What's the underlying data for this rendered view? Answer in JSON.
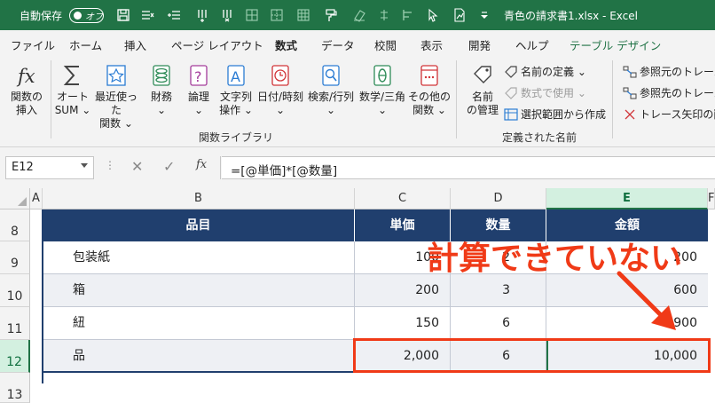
{
  "titlebar": {
    "autosave_label": "自動保存",
    "autosave_state": "オフ",
    "filename": "青色の請求書1.xlsx - Excel"
  },
  "tabs": [
    {
      "label": "ファイル"
    },
    {
      "label": "ホーム"
    },
    {
      "label": "挿入"
    },
    {
      "label": "ページ レイアウト"
    },
    {
      "label": "数式",
      "active": true
    },
    {
      "label": "データ"
    },
    {
      "label": "校閲"
    },
    {
      "label": "表示"
    },
    {
      "label": "開発"
    },
    {
      "label": "ヘルプ"
    },
    {
      "label": "テーブル デザイン",
      "contextual": true
    }
  ],
  "ribbon": {
    "function_library": {
      "insert_function": [
        "関数の",
        "挿入"
      ],
      "autosum": [
        "オート",
        "SUM ⌄"
      ],
      "recent": [
        "最近使った",
        "関数 ⌄"
      ],
      "financial": [
        "財務",
        "⌄"
      ],
      "logical": [
        "論理",
        "⌄"
      ],
      "text": [
        "文字列",
        "操作 ⌄"
      ],
      "datetime": [
        "日付/時刻",
        "⌄"
      ],
      "lookup": [
        "検索/行列",
        "⌄"
      ],
      "math": [
        "数学/三角",
        "⌄"
      ],
      "more": [
        "その他の",
        "関数 ⌄"
      ],
      "group_label": "関数ライブラリ"
    },
    "defined_names": {
      "name_manager": [
        "名前",
        "の管理"
      ],
      "define_name": "名前の定義 ⌄",
      "use_in_formula": "数式で使用 ⌄",
      "create_from_selection": "選択範囲から作成",
      "group_label": "定義された名前"
    },
    "auditing": {
      "trace_precedents": "参照元のトレース",
      "trace_dependents": "参照先のトレース",
      "remove_arrows": "トレース矢印の削除"
    }
  },
  "formula_bar": {
    "name_box": "E12",
    "formula": "=[@単価]*[@数量]"
  },
  "grid": {
    "columns": [
      "A",
      "B",
      "C",
      "D",
      "E",
      "F"
    ],
    "rows": [
      "8",
      "9",
      "10",
      "11",
      "12",
      "13"
    ],
    "table_headers": [
      "品目",
      "単価",
      "数量",
      "金額"
    ],
    "table_rows": [
      {
        "item": "包装紙",
        "price": "100",
        "qty": "2",
        "amount": "200"
      },
      {
        "item": "箱",
        "price": "200",
        "qty": "3",
        "amount": "600"
      },
      {
        "item": "紐",
        "price": "150",
        "qty": "6",
        "amount": "900"
      },
      {
        "item": "品",
        "price": "2,000",
        "qty": "6",
        "amount": "10,000"
      }
    ]
  },
  "annotation": {
    "callout": "計算できていない",
    "color": "#f03a17"
  },
  "colors": {
    "excel_green": "#217346",
    "table_header": "#203f6e"
  }
}
